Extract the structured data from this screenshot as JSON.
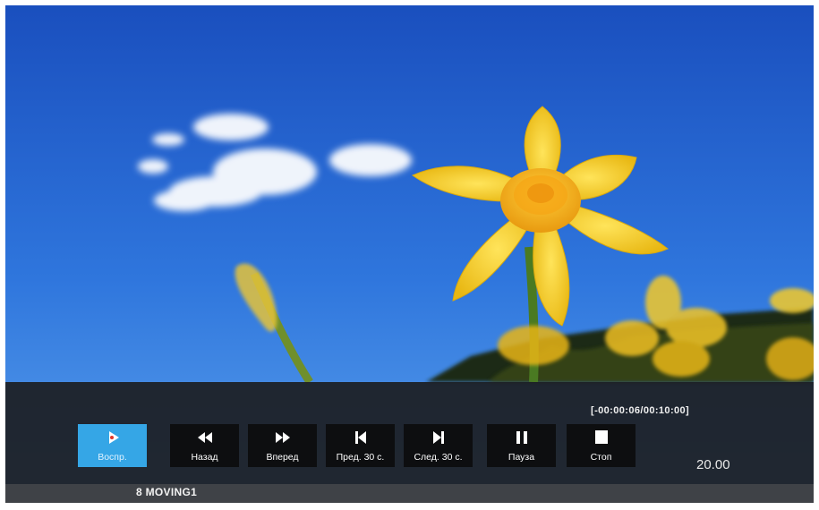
{
  "player": {
    "time_readout": "[-00:00:06/00:10:00]",
    "volume_readout": "20.00",
    "file_title": "8 MOVING1"
  },
  "controls": [
    {
      "label": "Воспр.",
      "icon": "play-icon",
      "active": true
    },
    {
      "label": "Назад",
      "icon": "rewind-icon"
    },
    {
      "label": "Вперед",
      "icon": "fast-forward-icon"
    },
    {
      "label": "Пред. 30 с.",
      "icon": "skip-back-icon"
    },
    {
      "label": "След. 30 с.",
      "icon": "skip-forward-icon"
    },
    {
      "label": "Пауза",
      "icon": "pause-icon"
    },
    {
      "label": "Стоп",
      "icon": "stop-icon"
    }
  ],
  "colors": {
    "active_button": "#35a6e6",
    "button_bg": "#0d0e10",
    "osd_bg": "#1c1e22",
    "status_bar_bg": "#3f4247",
    "sky": "#1f5fc9",
    "flower": "#f5cf25"
  }
}
